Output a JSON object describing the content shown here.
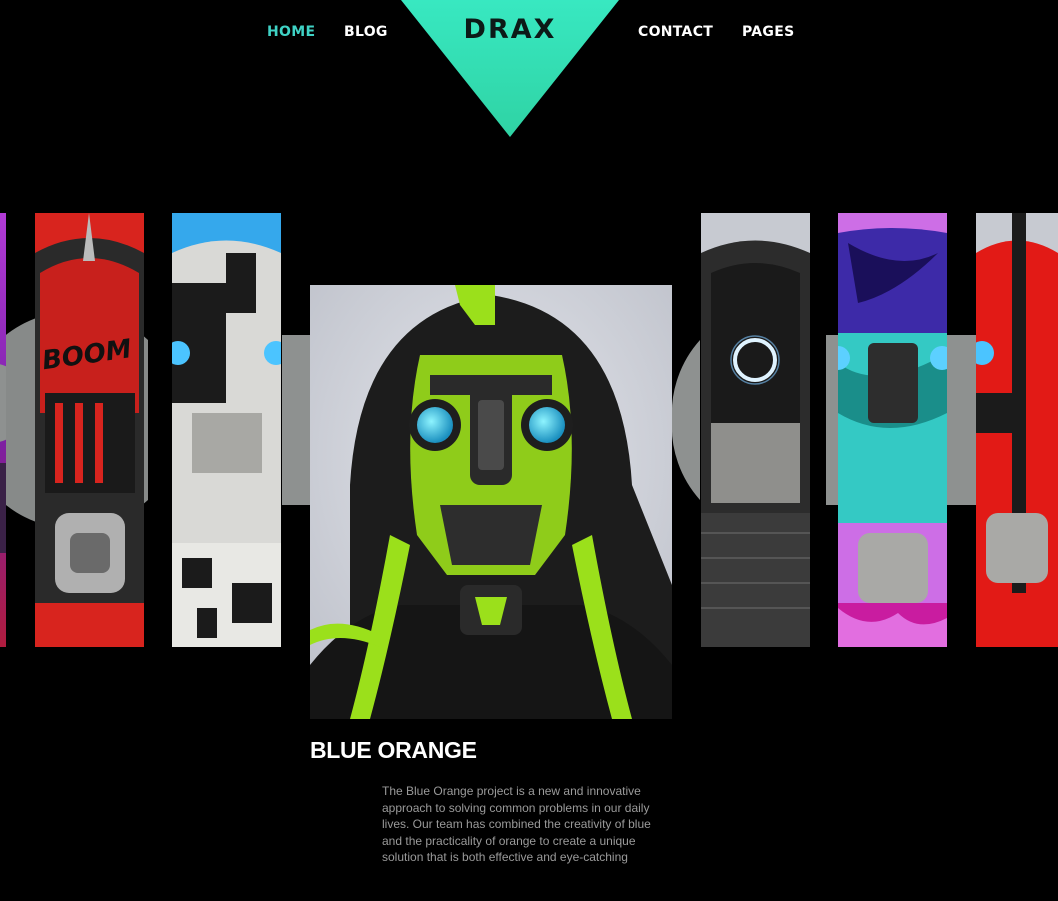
{
  "nav": {
    "home": "HOME",
    "blog": "BLOG",
    "contact": "CONTACT",
    "pages": "PAGES",
    "logo": "DRAX"
  },
  "colors": {
    "accent": "#3fd2c5",
    "logo_bg": "#35e6b9",
    "background": "#000000",
    "bg_letters": "#8e9190"
  },
  "featured": {
    "title": "BLUE ORANGE",
    "description": "The Blue Orange project is a new and innovative approach to solving common problems in our daily lives. Our team has combined the creativity of blue and the practicality of orange to create a unique solution that is both effective and eye-catching"
  },
  "gallery": {
    "items": [
      {
        "name": "purple-robot"
      },
      {
        "name": "red-boom-robot"
      },
      {
        "name": "white-black-robot"
      },
      {
        "name": "black-hooded-green-robot"
      },
      {
        "name": "chrome-ring-robot"
      },
      {
        "name": "teal-magenta-robot"
      },
      {
        "name": "red-black-robot"
      }
    ]
  }
}
